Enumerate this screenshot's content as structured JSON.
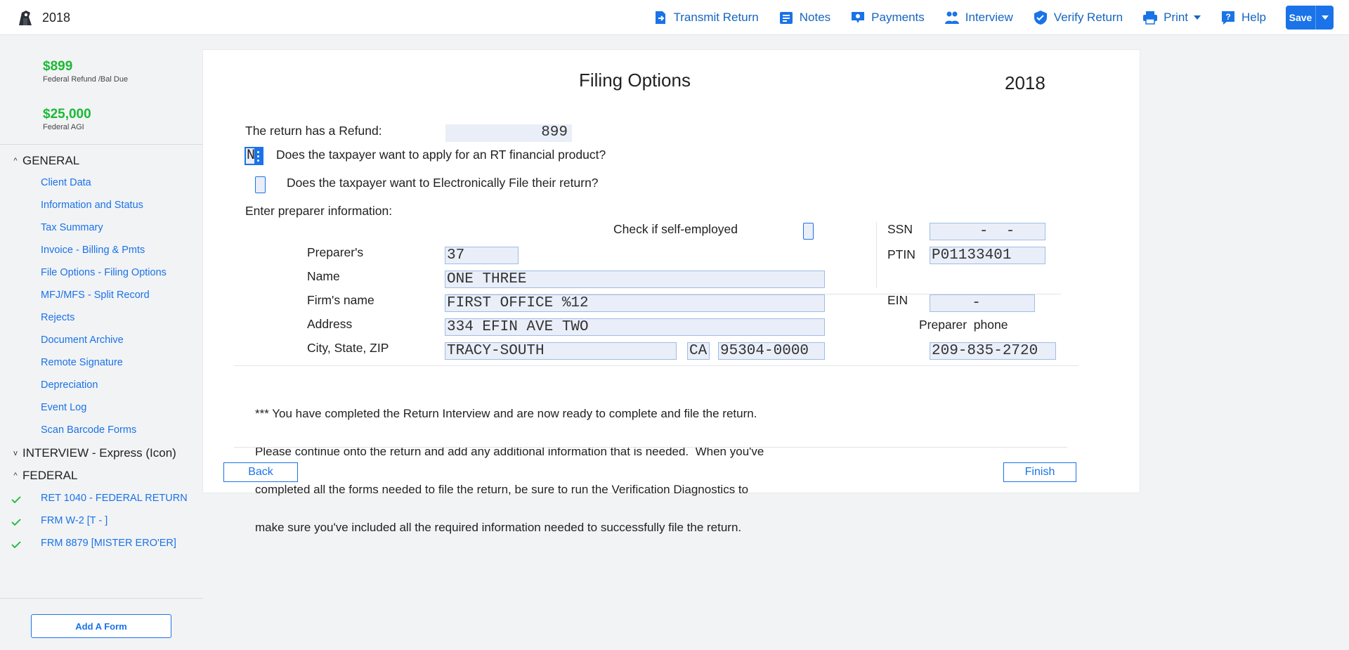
{
  "app": {
    "year": "2018"
  },
  "nav": {
    "transmit": "Transmit Return",
    "notes": "Notes",
    "payments": "Payments",
    "interview": "Interview",
    "verify": "Verify Return",
    "print": "Print",
    "help": "Help",
    "save": "Save"
  },
  "sidebar": {
    "refund_amount": "$899",
    "refund_label": "Federal Refund /Bal Due",
    "agi_amount": "$25,000",
    "agi_label": "Federal AGI",
    "general_title": "GENERAL",
    "general_items": [
      "Client Data",
      "Information and Status",
      "Tax Summary",
      "Invoice - Billing & Pmts",
      "File Options - Filing Options",
      "MFJ/MFS - Split Record",
      "Rejects",
      "Document Archive",
      "Remote Signature",
      "Depreciation",
      "Event Log",
      "Scan Barcode Forms"
    ],
    "interview_title": "INTERVIEW - Express (Icon)",
    "federal_title": "FEDERAL",
    "federal_items": [
      "RET 1040 - FEDERAL RETURN",
      "FRM W-2 [T - ]",
      "FRM 8879 [MISTER ERO'ER]"
    ],
    "add_form": "Add A Form"
  },
  "form": {
    "title": "Filing Options",
    "year": "2018",
    "refund_label": "The return has a Refund:",
    "refund_value": "899",
    "rt_value": "N",
    "rt_question": "Does the taxpayer want to apply for an RT financial product?",
    "efile_question": "Does the taxpayer want to Electronically File their return?",
    "preparer_heading": "Enter preparer information:",
    "self_employed_label": "Check if self-employed",
    "preparer_label": "Preparer's",
    "preparer_value": "37",
    "name_label": "Name",
    "name_value": "ONE THREE",
    "firm_label": "Firm's name",
    "firm_value": "FIRST OFFICE %12",
    "address_label": "Address",
    "address_value": "334 EFIN AVE TWO",
    "csz_label": "City, State, ZIP",
    "city_value": "TRACY-SOUTH",
    "state_value": "CA",
    "zip_value": "95304-0000",
    "ssn_label": "SSN",
    "ssn_value": "  -  -",
    "ptin_label": "PTIN",
    "ptin_value": "P01133401",
    "ein_label": "EIN",
    "ein_value": "  -",
    "phone_label": "Preparer  phone",
    "phone_value": "209-835-2720",
    "notice_lines": [
      "*** You have completed the Return Interview and are now ready to complete and file the return.",
      "Please continue onto the return and add any additional information that is needed.  When you've",
      "completed all the forms needed to file the return, be sure to run the Verification Diagnostics to",
      "make sure you've included all the required information needed to successfully file the return."
    ],
    "back": "Back",
    "finish": "Finish"
  }
}
